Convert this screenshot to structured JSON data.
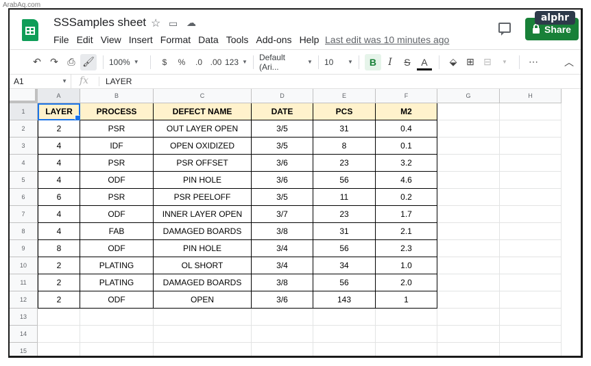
{
  "watermark": "ArabAq.com",
  "brand_badge": "alphr",
  "doc": {
    "title": "SSSamples sheet",
    "menu": [
      "File",
      "Edit",
      "View",
      "Insert",
      "Format",
      "Data",
      "Tools",
      "Add-ons",
      "Help"
    ],
    "last_edit": "Last edit was 10 minutes ago",
    "share_label": "Share"
  },
  "toolbar": {
    "zoom": "100%",
    "currency": "$",
    "percent": "%",
    "dec_decrease": ".0",
    "dec_increase": ".00",
    "more_formats": "123",
    "font": "Default (Ari...",
    "font_size": "10",
    "bold": "B",
    "italic": "I",
    "strike": "S",
    "text_color": "A",
    "more": "⋯"
  },
  "formula_bar": {
    "cell_ref": "A1",
    "fx": "fx",
    "value": "LAYER"
  },
  "columns": [
    "A",
    "B",
    "C",
    "D",
    "E",
    "F",
    "G",
    "H"
  ],
  "rows": [
    "1",
    "2",
    "3",
    "4",
    "5",
    "6",
    "7",
    "8",
    "9",
    "10",
    "11",
    "12",
    "13",
    "14",
    "15"
  ],
  "table": {
    "headers": [
      "LAYER",
      "PROCESS",
      "DEFECT NAME",
      "DATE",
      "PCS",
      "M2"
    ],
    "rows": [
      [
        "2",
        "PSR",
        "OUT LAYER OPEN",
        "3/5",
        "31",
        "0.4"
      ],
      [
        "4",
        "IDF",
        "OPEN OXIDIZED",
        "3/5",
        "8",
        "0.1"
      ],
      [
        "4",
        "PSR",
        "PSR OFFSET",
        "3/6",
        "23",
        "3.2"
      ],
      [
        "4",
        "ODF",
        "PIN HOLE",
        "3/6",
        "56",
        "4.6"
      ],
      [
        "6",
        "PSR",
        "PSR PEELOFF",
        "3/5",
        "11",
        "0.2"
      ],
      [
        "4",
        "ODF",
        "INNER LAYER OPEN",
        "3/7",
        "23",
        "1.7"
      ],
      [
        "4",
        "FAB",
        "DAMAGED BOARDS",
        "3/8",
        "31",
        "2.1"
      ],
      [
        "8",
        "ODF",
        "PIN HOLE",
        "3/4",
        "56",
        "2.3"
      ],
      [
        "2",
        "PLATING",
        "OL SHORT",
        "3/4",
        "34",
        "1.0"
      ],
      [
        "2",
        "PLATING",
        "DAMAGED BOARDS",
        "3/8",
        "56",
        "2.0"
      ],
      [
        "2",
        "ODF",
        "OPEN",
        "3/6",
        "143",
        "1"
      ]
    ]
  },
  "colors": {
    "header_fill": "#fff2cc",
    "share_green": "#188038",
    "selection_blue": "#1a73e8"
  }
}
